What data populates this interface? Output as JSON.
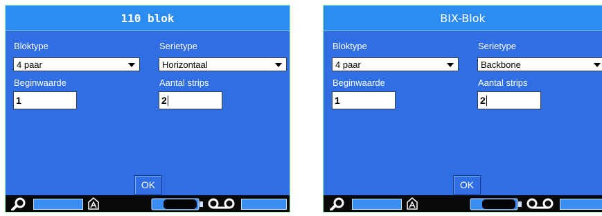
{
  "panels": [
    {
      "title": "110 blok",
      "bloktype_label": "Bloktype",
      "bloktype_value": "4 paar",
      "serietype_label": "Serietype",
      "serietype_value": "Horizontaal",
      "beginwaarde_label": "Beginwaarde",
      "beginwaarde_value": "1",
      "aantal_label": "Aantal strips",
      "aantal_value": "2",
      "ok_label": "OK"
    },
    {
      "title": "BIX-Blok",
      "bloktype_label": "Bloktype",
      "bloktype_value": "4 paar",
      "serietype_label": "Serietype",
      "serietype_value": "Backbone",
      "beginwaarde_label": "Beginwaarde",
      "beginwaarde_value": "1",
      "aantal_label": "Aantal strips",
      "aantal_value": "2",
      "ok_label": "OK"
    }
  ],
  "status_icons": [
    "search-icon",
    "label-house-icon",
    "battery-icon",
    "tape-reel-icon"
  ],
  "colors": {
    "panel_bg": "#2f6ee3",
    "title_bg": "#2d8cf0",
    "status_bg": "#080808",
    "border": "#9ef0a8"
  }
}
